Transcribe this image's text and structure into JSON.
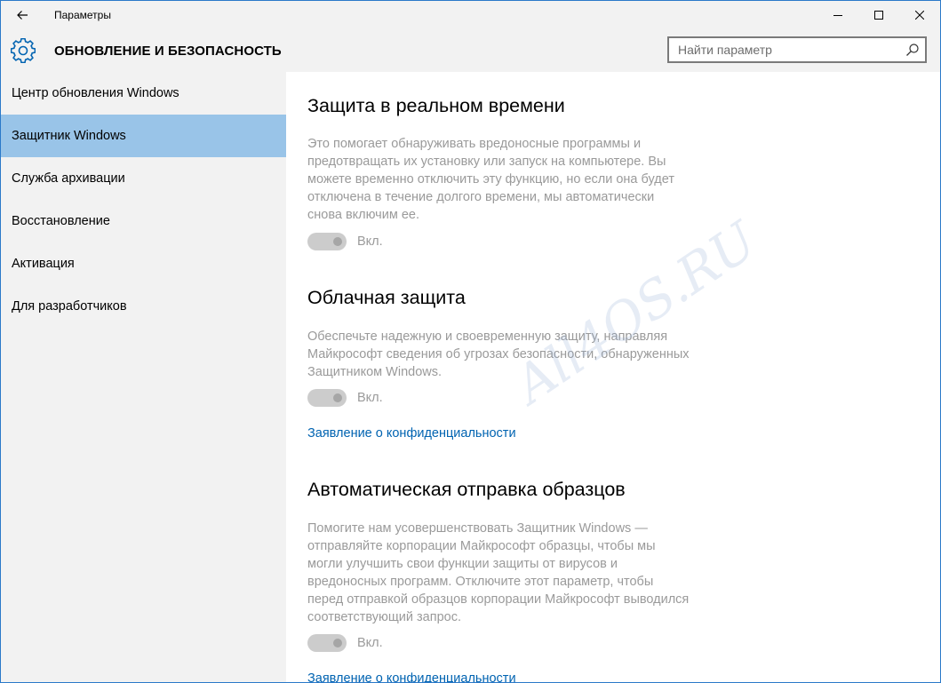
{
  "window": {
    "title": "Параметры"
  },
  "header": {
    "title": "ОБНОВЛЕНИЕ И БЕЗОПАСНОСТЬ",
    "search_placeholder": "Найти параметр"
  },
  "sidebar": {
    "items": [
      {
        "label": "Центр обновления Windows"
      },
      {
        "label": "Защитник Windows",
        "active": true
      },
      {
        "label": "Служба архивации"
      },
      {
        "label": "Восстановление"
      },
      {
        "label": "Активация"
      },
      {
        "label": "Для разработчиков"
      }
    ]
  },
  "main": {
    "sections": [
      {
        "title": "Защита в реальном времени",
        "description": "Это помогает обнаруживать вредоносные программы и предотвращать их установку или запуск на компьютере. Вы можете временно отключить эту функцию, но если она будет отключена в течение долгого времени, мы автоматически снова включим ее.",
        "toggle_label": "Вкл.",
        "toggle_on": true
      },
      {
        "title": "Облачная защита",
        "description": "Обеспечьте надежную и своевременную защиту, направляя Майкрософт сведения об угрозах безопасности, обнаруженных Защитником Windows.",
        "toggle_label": "Вкл.",
        "toggle_on": true,
        "link": "Заявление о конфиденциальности"
      },
      {
        "title": "Автоматическая отправка образцов",
        "description": "Помогите нам усовершенствовать Защитник Windows — отправляйте корпорации Майкрософт образцы, чтобы мы могли улучшить свои функции защиты от вирусов и вредоносных программ. Отключите этот параметр, чтобы перед отправкой образцов корпорации Майкрософт выводился соответствующий запрос.",
        "toggle_label": "Вкл.",
        "toggle_on": true,
        "link": "Заявление о конфиденциальности"
      }
    ]
  },
  "watermark": "All4OS.RU",
  "colors": {
    "accent": "#0063b1",
    "active_item": "#99c4e8",
    "chrome": "#f2f2f2",
    "disabled_text": "#9a9a9a"
  },
  "icons": [
    "back-arrow-icon",
    "minimize-icon",
    "maximize-icon",
    "close-icon",
    "gear-icon",
    "search-icon"
  ]
}
